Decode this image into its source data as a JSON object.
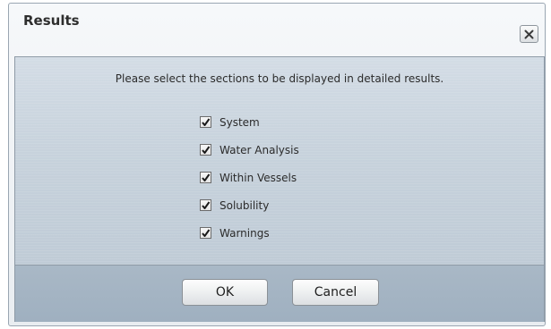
{
  "dialog": {
    "title": "Results",
    "close_icon": "close-icon",
    "instruction": "Please select the sections to be displayed in detailed results.",
    "options": [
      {
        "label": "System",
        "checked": true
      },
      {
        "label": "Water Analysis",
        "checked": true
      },
      {
        "label": "Within Vessels",
        "checked": true
      },
      {
        "label": "Solubility",
        "checked": true
      },
      {
        "label": "Warnings",
        "checked": true
      }
    ],
    "ok_label": "OK",
    "cancel_label": "Cancel"
  },
  "colors": {
    "content_bg": "#c7d2dc",
    "footer_bg": "#a3b3c3",
    "border": "#8e9aa6"
  }
}
